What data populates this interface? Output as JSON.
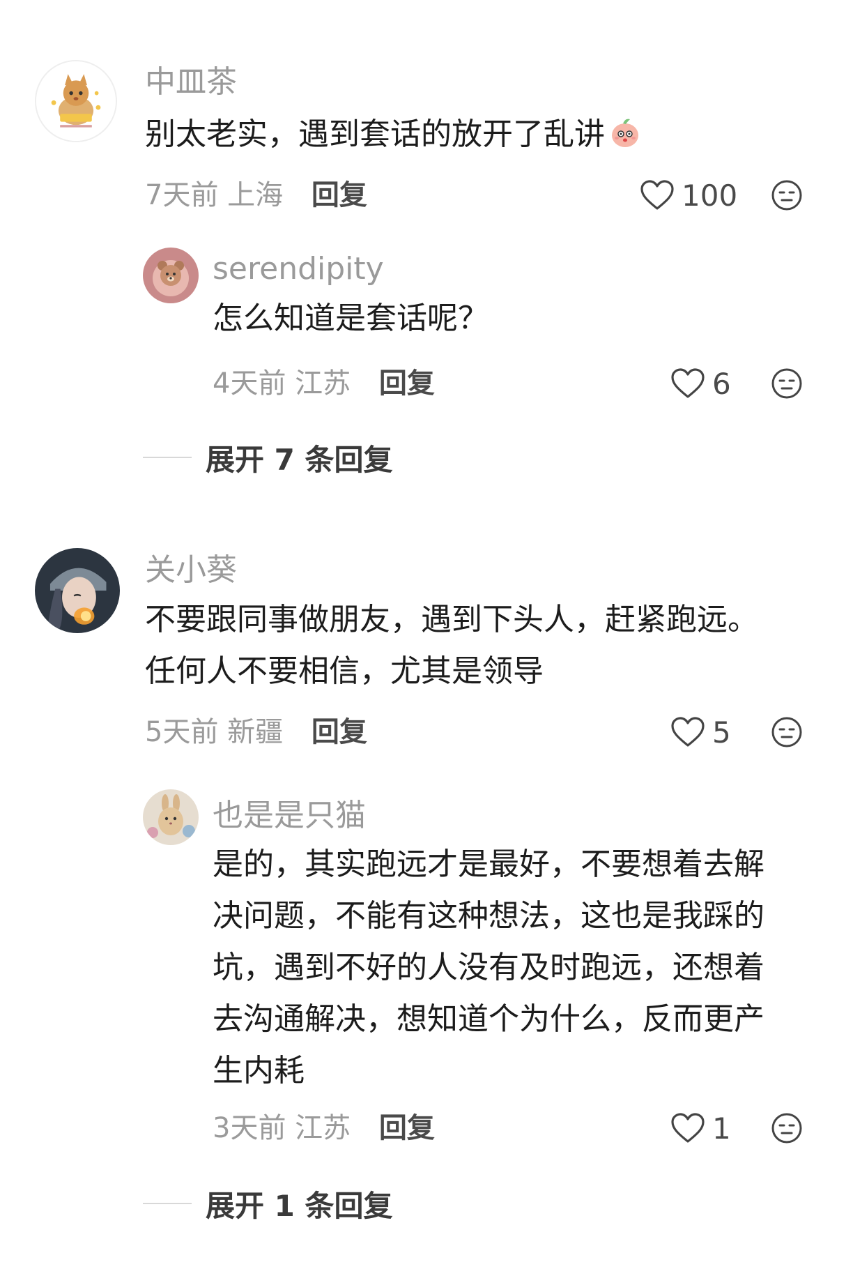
{
  "comments": [
    {
      "username": "中皿茶",
      "lines": [
        "别太老实，遇到套话的放开了乱讲"
      ],
      "emoji": "peach-face-emoji",
      "time": "7天前",
      "location": "上海",
      "reply_label": "回复",
      "likes": "100"
    },
    {
      "username": "serendipity",
      "lines": [
        "怎么知道是套话呢？"
      ],
      "time": "4天前",
      "location": "江苏",
      "reply_label": "回复",
      "likes": "6"
    },
    {
      "username": "关小葵",
      "lines": [
        "不要跟同事做朋友，遇到下头人，赶紧跑远。",
        "任何人不要相信，尤其是领导"
      ],
      "time": "5天前",
      "location": "新疆",
      "reply_label": "回复",
      "likes": "5"
    },
    {
      "username": "也是是只猫",
      "lines": [
        "是的，其实跑远才是最好，不要想着去解",
        "决问题，不能有这种想法，这也是我踩的",
        "坑，遇到不好的人没有及时跑远，还想着",
        "去沟通解决，想知道个为什么，反而更产",
        "生内耗"
      ],
      "time": "3天前",
      "location": "江苏",
      "reply_label": "回复",
      "likes": "1"
    }
  ],
  "expand": [
    {
      "label": "展开 7 条回复"
    },
    {
      "label": "展开 1 条回复"
    }
  ],
  "icons": {
    "like": "heart-outline-icon",
    "dislike": "neutral-face-icon"
  },
  "colors": {
    "username": "#9a9a9a",
    "text": "#1c1c1c",
    "meta": "#9a9a9a",
    "reply": "#4a4a4a"
  }
}
